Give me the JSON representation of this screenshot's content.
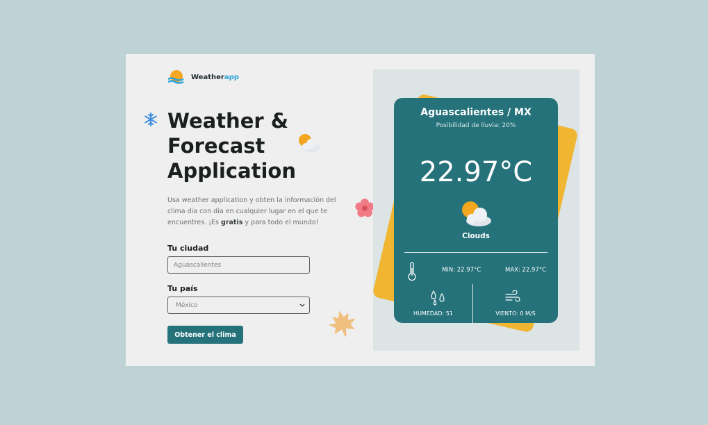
{
  "brand": {
    "name": "Weather",
    "accent": "app"
  },
  "hero": {
    "title": "Weather & Forecast Application"
  },
  "description": {
    "part1": "Usa weather application y obten la información del clima dia con dia en cualquier lugar en el que te encuentres. ¡Es ",
    "bold": "gratis",
    "part2": " y para todo el mundo!"
  },
  "form": {
    "city_label": "Tu ciudad",
    "city_value": "Aguascalientes",
    "country_label": "Tu país",
    "country_value": "México",
    "submit_label": "Obtener el clima"
  },
  "weather": {
    "location": "Aguascalientes / MX",
    "rain_chance": "Posibilidad de lluvia: 20%",
    "temperature": "22.97°C",
    "condition": "Clouds",
    "min": "MIN: 22.97°C",
    "max": "MAX: 22.97°C",
    "humidity": "HUMEDAD: 51",
    "wind": "VIENTO: 0 M/S"
  },
  "icons": [
    "weather-logo-icon",
    "snowflake-icon",
    "sun-cloud-icon",
    "flower-icon",
    "maple-leaf-icon",
    "thermometer-icon",
    "drops-icon",
    "wind-icon",
    "chevron-down-icon"
  ],
  "colors": {
    "background": "#bfd3d6",
    "teal": "#25727b",
    "yellow": "#f0b531",
    "accent_blue": "#2ea3dc"
  }
}
